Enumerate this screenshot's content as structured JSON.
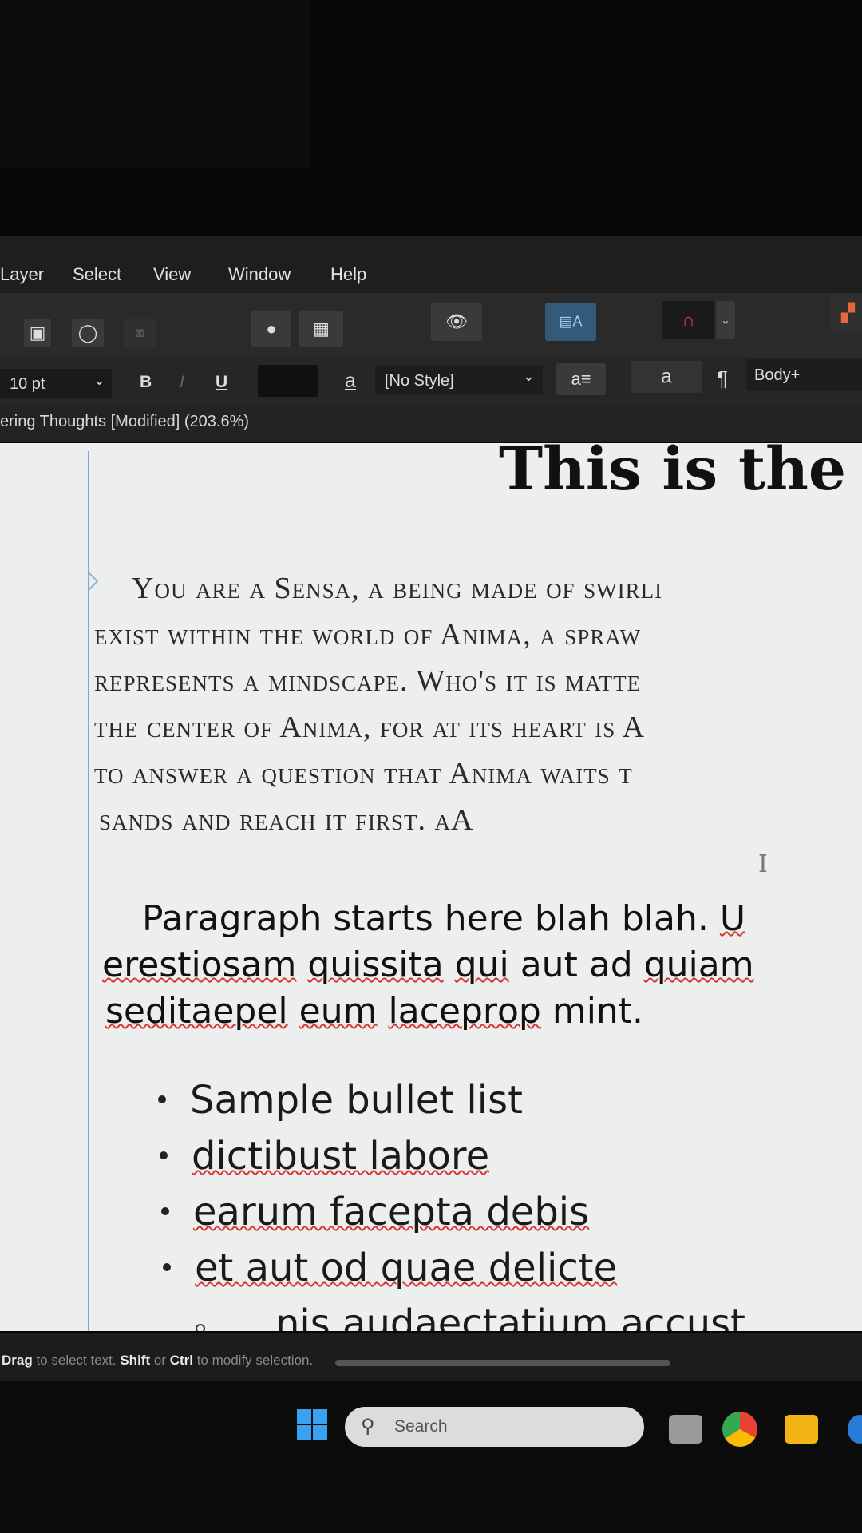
{
  "menu": [
    "Layer",
    "Select",
    "View",
    "Window",
    "Help"
  ],
  "controls": {
    "font_size": "10 pt",
    "bold": "B",
    "italic": "I",
    "underline": "U",
    "char_style_glyph": "a",
    "paragraph_style": "[No Style]",
    "para_glyph": "a",
    "pilcrow": "¶",
    "para_style_name": "Body+"
  },
  "document_tab": "ering Thoughts [Modified] (203.6%)",
  "document": {
    "heading": "This is the",
    "smallcaps_lines": [
      "You are a Sensa, a being made of swirli",
      "exist within the world of Anima, a spraw",
      "represents a mindscape. Who's it is matte",
      "the center of Anima, for at its heart is A",
      "to answer a question that Anima waits t",
      "sands and reach it first. aA"
    ],
    "paragraph_lines": {
      "l1_plain": "Paragraph starts here blah blah. ",
      "l1_sq": "U",
      "l2_w1": "erestiosam",
      "l2_w2": "quissita",
      "l2_w3": "qui",
      "l2_w4": "aut",
      "l2_w5": "ad",
      "l2_w6": "quiam",
      "l3_w1": "seditaepel",
      "l3_w2": "eum",
      "l3_w3": "laceprор",
      "l3_end": "mint."
    },
    "bullets": [
      "Sample bullet list",
      "dictibust labore",
      "earum facepta debis",
      "et aut od quae delicte"
    ],
    "sub_bullet": "nis audaectatium accust"
  },
  "status": {
    "drag": "Drag",
    "t1": " to select text. ",
    "shift": "Shift",
    "t2": " or ",
    "ctrl": "Ctrl",
    "t3": " to modify selection."
  },
  "taskbar": {
    "search_placeholder": "Search"
  },
  "colors": {
    "menu_bg": "#1e1e1e",
    "doc_bg": "#ecefed",
    "margin_guide": "#7fa6d9",
    "spellcheck": "#dd3333"
  }
}
